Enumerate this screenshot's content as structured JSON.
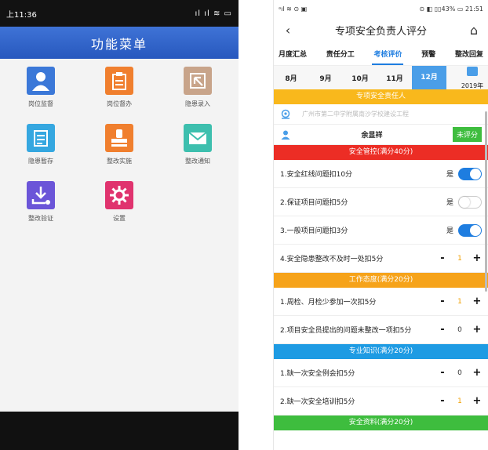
{
  "left_phone": {
    "status": {
      "time": "上11:36",
      "icons": "ıl ıl ≋ ▭"
    },
    "app_title": "功能菜单",
    "tiles": [
      {
        "label": "岗位监督",
        "color": "#3b78d8",
        "icon": "person-icon"
      },
      {
        "label": "岗位督办",
        "color": "#f07f2e",
        "icon": "clipboard-icon"
      },
      {
        "label": "隐患录入",
        "color": "#c8a48a",
        "icon": "entry-icon"
      },
      {
        "label": "隐患暂存",
        "color": "#35a7e0",
        "icon": "document-icon"
      },
      {
        "label": "整改实施",
        "color": "#f07f2e",
        "icon": "stamp-icon"
      },
      {
        "label": "整改通知",
        "color": "#3dbfae",
        "icon": "mail-icon"
      },
      {
        "label": "整改验证",
        "color": "#6b55d8",
        "icon": "download-icon"
      },
      {
        "label": "设置",
        "color": "#e0336e",
        "icon": "gear-icon"
      }
    ]
  },
  "right_phone": {
    "status": {
      "left": "ᵃıl ≋ ⊙ ▣",
      "right": "⊙ ◧ ▯▯43% ▭ 21:51"
    },
    "title": "专项安全负责人评分",
    "tabs": [
      {
        "label": "月度汇总",
        "active": false
      },
      {
        "label": "责任分工",
        "active": false
      },
      {
        "label": "考核评价",
        "active": true
      },
      {
        "label": "预警",
        "active": false
      },
      {
        "label": "整改回复",
        "active": false
      }
    ],
    "months": [
      {
        "label": "8月",
        "active": false
      },
      {
        "label": "9月",
        "active": false
      },
      {
        "label": "10月",
        "active": false
      },
      {
        "label": "11月",
        "active": false
      },
      {
        "label": "12月",
        "active": true
      }
    ],
    "year": "2019年",
    "responsible_header": "专项安全责任人",
    "place": "广州市第二中学附属南沙学校建设工程",
    "person": "余显祥",
    "status_badge": "未评分",
    "sections": [
      {
        "title": "安全管控(满分40分)",
        "color": "red",
        "rows": [
          {
            "text": "1.安全红线问题扣10分",
            "kind": "toggle",
            "yes_label": "是",
            "on": true
          },
          {
            "text": "2.保证项目问题扣5分",
            "kind": "toggle",
            "yes_label": "是",
            "on": false
          },
          {
            "text": "3.一般项目问题扣3分",
            "kind": "toggle",
            "yes_label": "是",
            "on": true
          },
          {
            "text": "4.安全隐患整改不及时一处扣5分",
            "kind": "stepper",
            "value": "1",
            "highlight": true
          }
        ]
      },
      {
        "title": "工作态度(满分20分)",
        "color": "orange",
        "rows": [
          {
            "text": "1.周检、月检少参加一次扣5分",
            "kind": "stepper",
            "value": "1",
            "highlight": true
          },
          {
            "text": "2.项目安全员提出的问题未整改一项扣5分",
            "kind": "stepper",
            "value": "0",
            "highlight": false
          }
        ]
      },
      {
        "title": "专业知识(满分20分)",
        "color": "blue",
        "rows": [
          {
            "text": "1.缺一次安全例会扣5分",
            "kind": "stepper",
            "value": "0",
            "highlight": false
          },
          {
            "text": "2.缺一次安全培训扣5分",
            "kind": "stepper",
            "value": "1",
            "highlight": true
          }
        ]
      },
      {
        "title": "安全资料(满分20分)",
        "color": "green",
        "rows": []
      }
    ],
    "stepper_minus": "-",
    "stepper_plus": "+",
    "back_icon": "‹",
    "home_icon": "⌂"
  }
}
